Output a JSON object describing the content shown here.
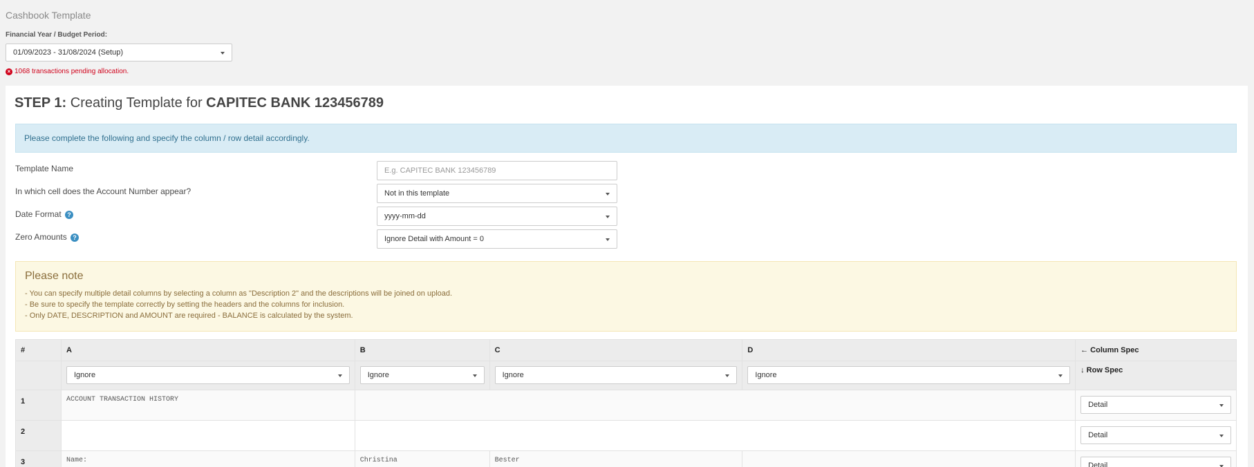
{
  "header": {
    "title": "Cashbook Template",
    "fy_label": "Financial Year / Budget Period:",
    "fy_value": "01/09/2023 - 31/08/2024 (Setup)",
    "pending": "1068 transactions pending allocation."
  },
  "step": {
    "prefix": "STEP 1:",
    "middle": " Creating Template for ",
    "bank": "CAPITEC BANK 123456789"
  },
  "info": "Please complete the following and specify the column / row detail accordingly.",
  "form": {
    "template_name_label": "Template Name",
    "template_name_placeholder": "E.g. CAPITEC BANK 123456789",
    "account_cell_label": "In which cell does the Account Number appear?",
    "account_cell_value": "Not in this template",
    "date_format_label": "Date Format",
    "date_format_value": "yyyy-mm-dd",
    "zero_amounts_label": "Zero Amounts",
    "zero_amounts_value": "Ignore Detail with Amount = 0",
    "help_glyph": "?"
  },
  "note": {
    "title": "Please note",
    "lines": [
      "- You can specify multiple detail columns by selecting a column as \"Description 2\" and the descriptions will be joined on upload.",
      "- Be sure to specify the template correctly by setting the headers and the columns for inclusion.",
      "- Only DATE, DESCRIPTION and AMOUNT are required - BALANCE is calculated by the system."
    ]
  },
  "grid": {
    "hash": "#",
    "columns": [
      "A",
      "B",
      "C",
      "D"
    ],
    "column_spec": "← Column Spec",
    "row_spec": "↓ Row Spec",
    "column_selects": [
      "Ignore",
      "Ignore",
      "Ignore",
      "Ignore"
    ],
    "rows": [
      {
        "num": "1",
        "a": "ACCOUNT TRANSACTION HISTORY",
        "b": "",
        "c": "",
        "d": "",
        "spec": "Detail"
      },
      {
        "num": "2",
        "a": "",
        "b": "",
        "c": "",
        "d": "",
        "spec": "Detail"
      },
      {
        "num": "3",
        "a": "Name:",
        "b": "Christina",
        "c": "Bester",
        "d": "",
        "spec": "Detail"
      }
    ]
  },
  "colors": {
    "error": "#d0021b",
    "info_bg": "#d9ecf5",
    "note_bg": "#fcf8e3",
    "help": "#3b8fc2"
  }
}
